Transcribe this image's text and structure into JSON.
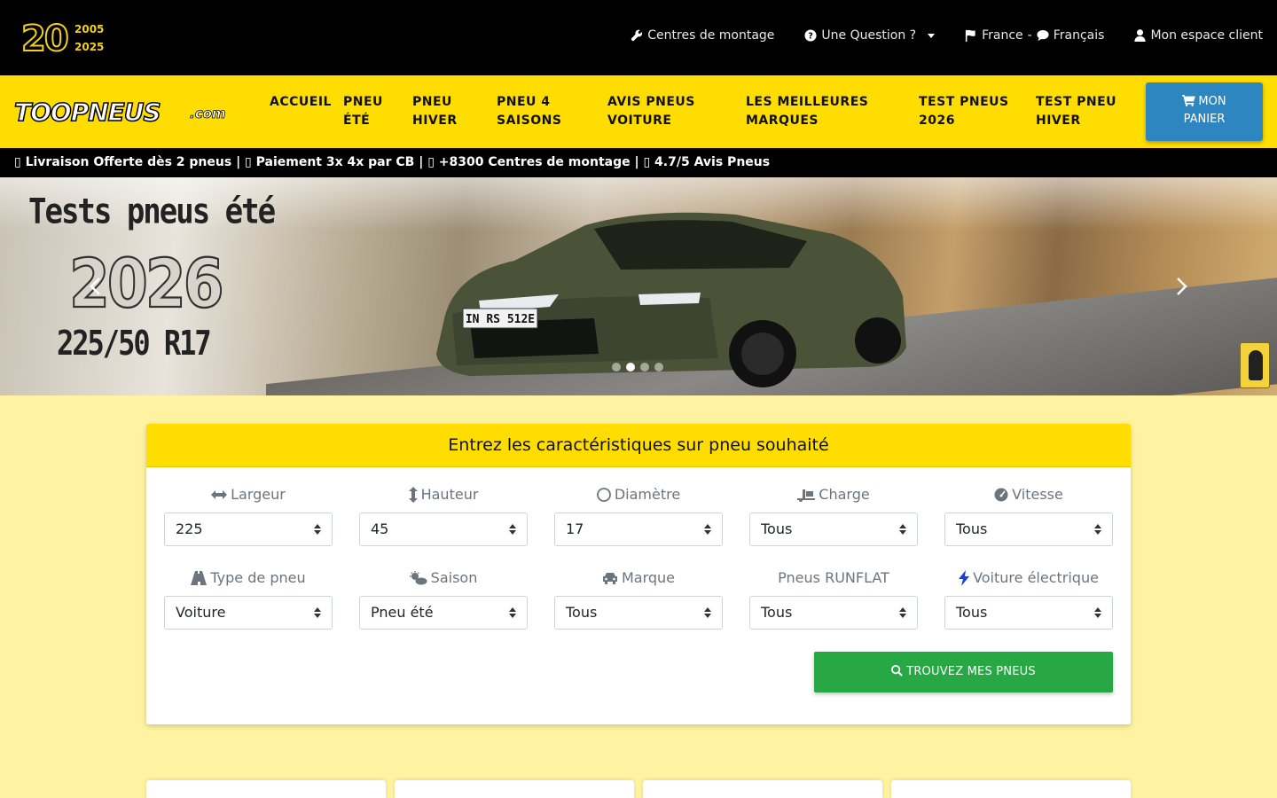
{
  "anniversary": {
    "number": "20",
    "year_start": "2005",
    "year_end": "2025"
  },
  "toplinks": {
    "mounting_centers": "Centres de montage",
    "question": "Une Question ?",
    "country": "France",
    "separator": "-",
    "language": "Français",
    "account": "Mon espace client"
  },
  "logo": {
    "word": "TOOPNEUS",
    "suffix": ".com"
  },
  "nav": {
    "items": [
      {
        "line1": "ACCUEIL",
        "line2": ""
      },
      {
        "line1": "PNEU",
        "line2": "ÉTÉ"
      },
      {
        "line1": "PNEU",
        "line2": "HIVER"
      },
      {
        "line1": "PNEU 4",
        "line2": "SAISONS"
      },
      {
        "line1": "AVIS PNEUS",
        "line2": "VOITURE"
      },
      {
        "line1": "LES MEILLEURES",
        "line2": "MARQUES"
      },
      {
        "line1": "TEST PNEUS",
        "line2": "2026"
      },
      {
        "line1": "TEST PNEU",
        "line2": "HIVER"
      }
    ],
    "cart_line1": "MON",
    "cart_line2": "PANIER"
  },
  "promo": "▯ Livraison Offerte dès 2 pneus | ▯ Paiement 3x 4x par CB | ▯ +8300 Centres de montage | ▯ 4.7/5 Avis Pneus",
  "hero": {
    "title": "Tests pneus été",
    "year": "2026",
    "size": "225/50 R17",
    "plate": "IN RS 512E",
    "slides": 4,
    "active_slide": 2
  },
  "search": {
    "header": "Entrez les caractéristiques sur pneu souhaité",
    "fields": [
      {
        "label": "Largeur",
        "value": "225",
        "icon": "width-arrows-icon"
      },
      {
        "label": "Hauteur",
        "value": "45",
        "icon": "height-arrows-icon"
      },
      {
        "label": "Diamètre",
        "value": "17",
        "icon": "circle-icon"
      },
      {
        "label": "Charge",
        "value": "Tous",
        "icon": "truck-loading-icon"
      },
      {
        "label": "Vitesse",
        "value": "Tous",
        "icon": "speedometer-icon"
      },
      {
        "label": "Type de pneu",
        "value": "Voiture",
        "icon": "road-icon"
      },
      {
        "label": "Saison",
        "value": "Pneu été",
        "icon": "sun-cloud-icon"
      },
      {
        "label": "Marque",
        "value": "Tous",
        "icon": "car-icon"
      },
      {
        "label": "Pneus RUNFLAT",
        "value": "Tous",
        "icon": ""
      },
      {
        "label": "Voiture électrique",
        "value": "Tous",
        "icon": "bolt-icon"
      }
    ],
    "button": "TROUVEZ MES PNEUS"
  },
  "colors": {
    "brand_yellow": "#ffdd00",
    "page_bg": "#fff3a1",
    "cart_blue": "#2e86c1",
    "cta_green": "#28a745",
    "bolt_blue": "#1a3fd1"
  }
}
